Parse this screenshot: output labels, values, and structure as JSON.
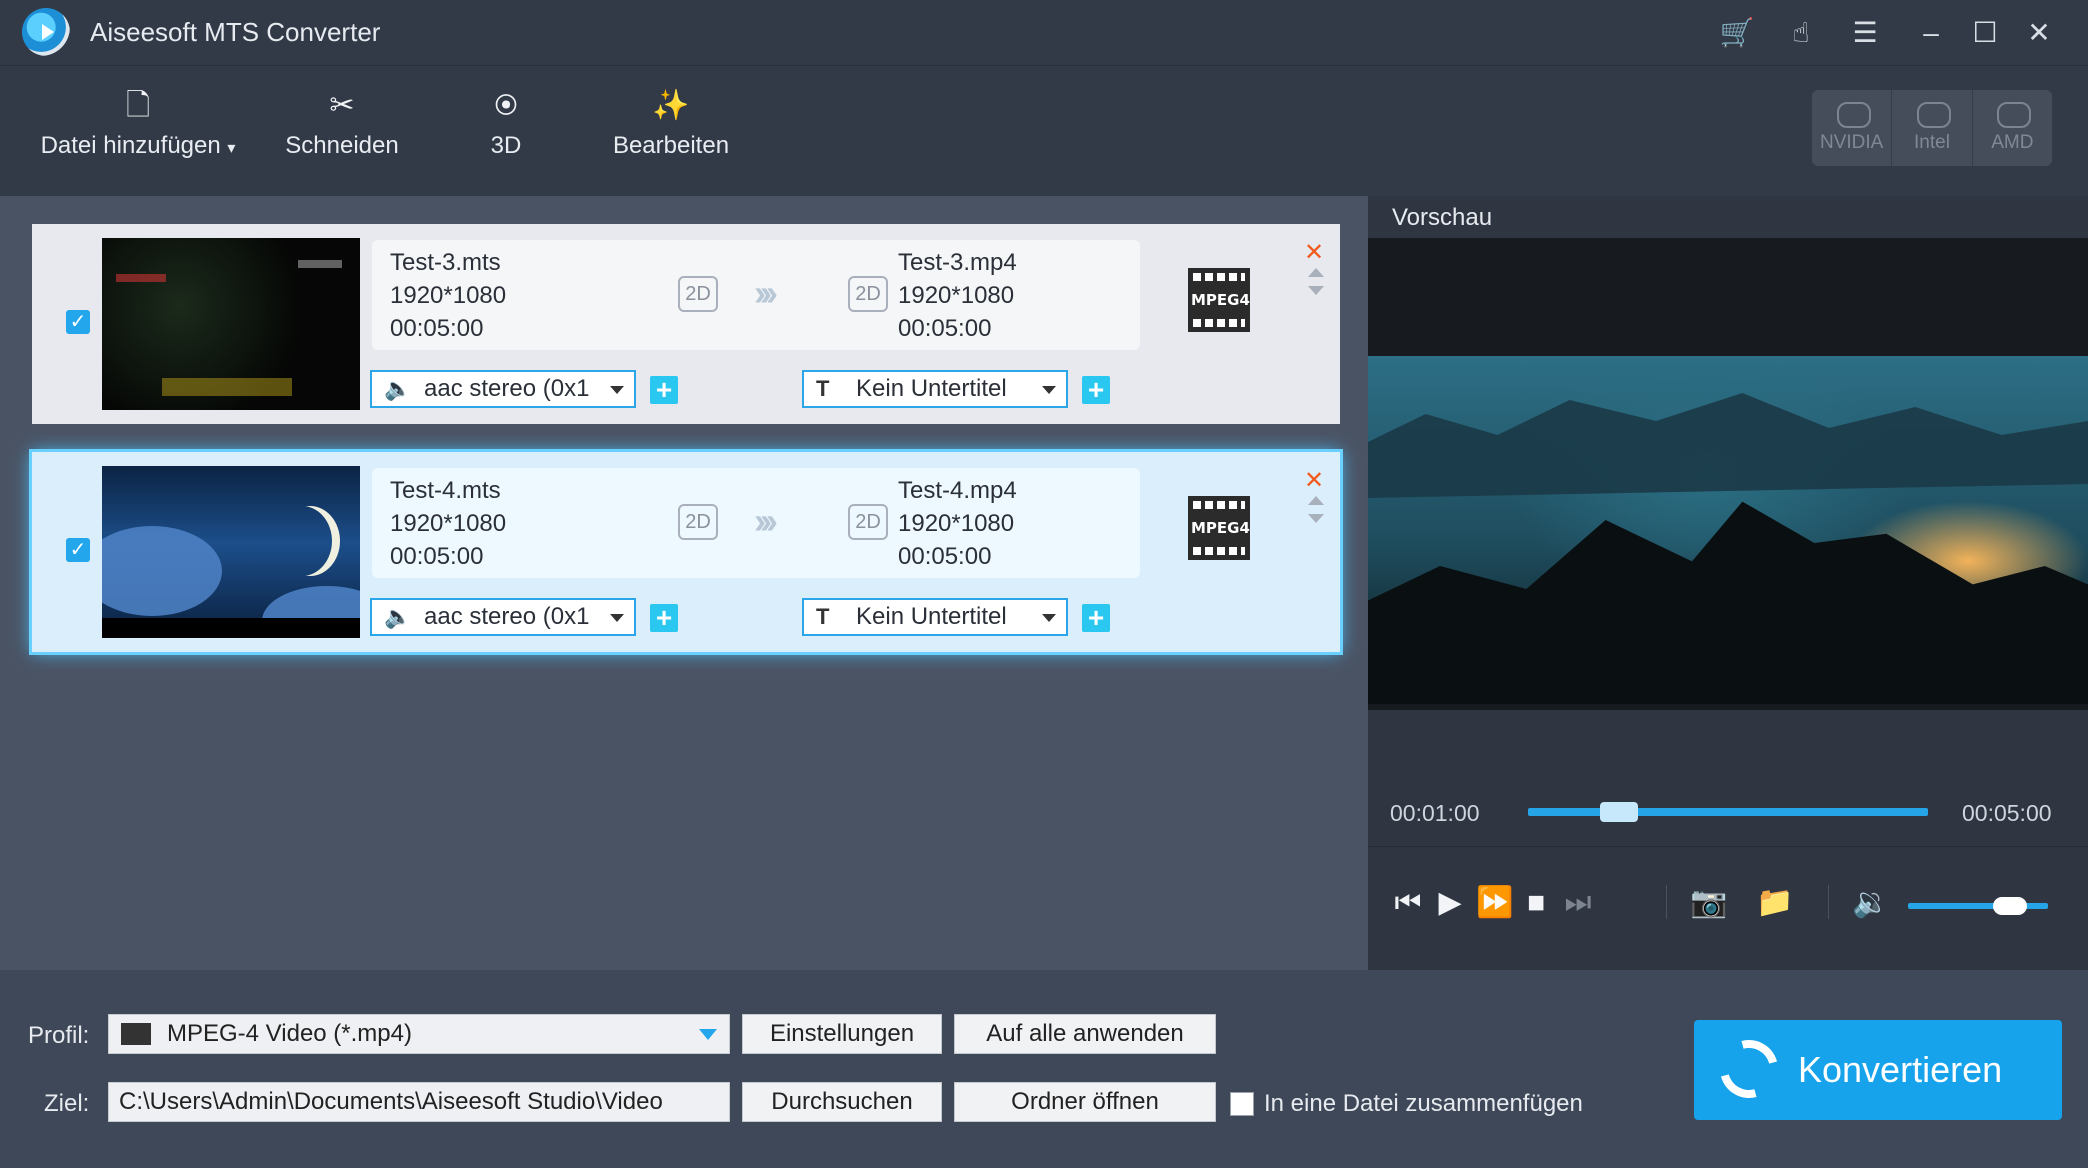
{
  "app": {
    "title": "Aiseesoft MTS Converter"
  },
  "titlebar_icons": [
    "cart-icon",
    "touch-icon",
    "feedback-icon",
    "minimize-icon",
    "maximize-icon",
    "close-icon"
  ],
  "toolbar": {
    "add_file": "Datei hinzufügen",
    "cut": "Schneiden",
    "three_d": "3D",
    "edit": "Bearbeiten",
    "gpu": [
      "NVIDIA",
      "Intel",
      "AMD"
    ]
  },
  "files": [
    {
      "checked": true,
      "src_name": "Test-3.mts",
      "src_res": "1920*1080",
      "src_dur": "00:05:00",
      "src_mode": "2D",
      "dst_name": "Test-3.mp4",
      "dst_res": "1920*1080",
      "dst_dur": "00:05:00",
      "dst_mode": "2D",
      "audio": "aac stereo (0x1",
      "subtitle": "Kein Untertitel",
      "format_badge": "MPEG4"
    },
    {
      "checked": true,
      "src_name": "Test-4.mts",
      "src_res": "1920*1080",
      "src_dur": "00:05:00",
      "src_mode": "2D",
      "dst_name": "Test-4.mp4",
      "dst_res": "1920*1080",
      "dst_dur": "00:05:00",
      "dst_mode": "2D",
      "audio": "aac stereo (0x1",
      "subtitle": "Kein Untertitel",
      "format_badge": "MPEG4"
    }
  ],
  "preview": {
    "title": "Vorschau",
    "time_current": "00:01:00",
    "time_total": "00:05:00",
    "progress": 0.2,
    "volume": 0.8
  },
  "bottom": {
    "profile_label": "Profil:",
    "profile_value": "MPEG-4 Video (*.mp4)",
    "settings_btn": "Einstellungen",
    "apply_all_btn": "Auf alle anwenden",
    "dest_label": "Ziel:",
    "dest_value": "C:\\Users\\Admin\\Documents\\Aiseesoft Studio\\Video",
    "browse_btn": "Durchsuchen",
    "open_folder_btn": "Ordner öffnen",
    "merge_label": "In eine Datei zusammenfügen",
    "convert_btn": "Konvertieren"
  },
  "colors": {
    "accent": "#17a3ec",
    "background": "#3e4757",
    "delete": "#f05a1e"
  }
}
